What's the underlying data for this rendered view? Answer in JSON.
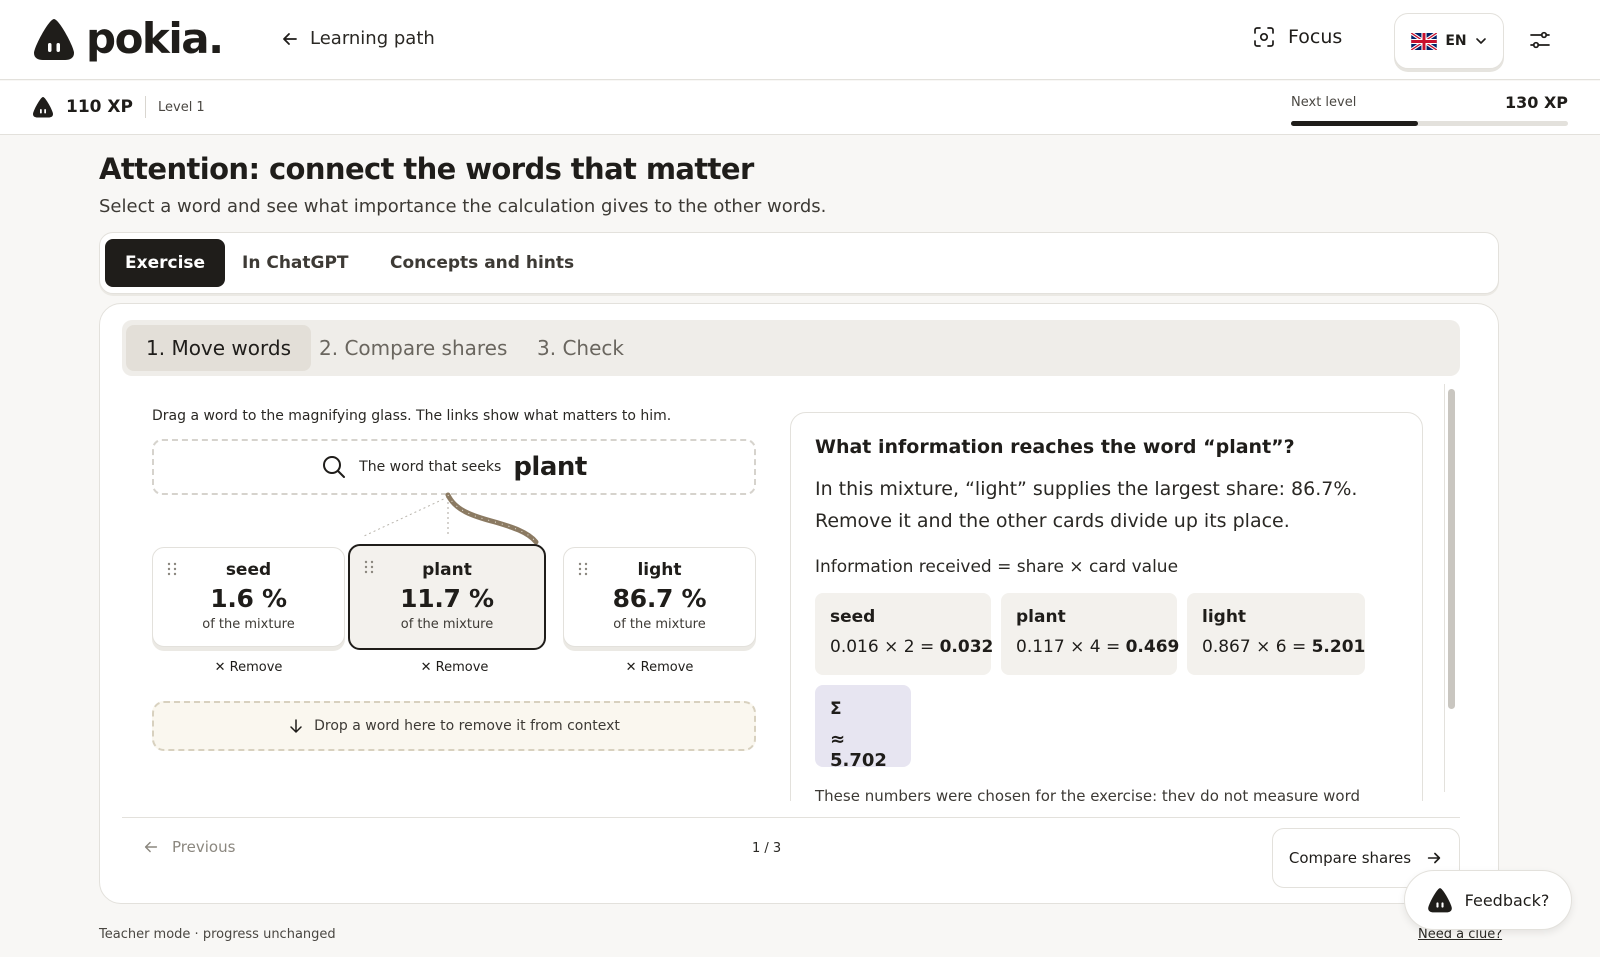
{
  "header": {
    "logo_text": "pokia.",
    "back_label": "Learning path",
    "focus_label": "Focus",
    "language": "EN"
  },
  "xp": {
    "current": "110 XP",
    "level": "Level 1",
    "next_label": "Next level",
    "next_value": "130 XP",
    "progress_fraction": 0.46
  },
  "page": {
    "title": "Attention: connect the words that matter",
    "subtitle": "Select a word and see what importance the calculation gives to the other words."
  },
  "tabs": [
    "Exercise",
    "In ChatGPT",
    "Concepts and hints"
  ],
  "steps": [
    "1. Move words",
    "2. Compare shares",
    "3. Check"
  ],
  "exercise": {
    "instruction": "Drag a word to the magnifying glass. The links show what matters to him.",
    "seek_label": "The word that seeks",
    "seek_word": "plant",
    "cards": [
      {
        "word": "seed",
        "pct": "1.6 %",
        "sub": "of the mixture",
        "remove": "Remove"
      },
      {
        "word": "plant",
        "pct": "11.7 %",
        "sub": "of the mixture",
        "remove": "Remove"
      },
      {
        "word": "light",
        "pct": "86.7 %",
        "sub": "of the mixture",
        "remove": "Remove"
      }
    ],
    "drop_label": "Drop a word here to remove it from context"
  },
  "info": {
    "title": "What information reaches the word “plant”?",
    "body": "In this mixture, “light” supplies the largest share: 86.7%. Remove it and the other cards divide up its place.",
    "formula": "Information received = share × card value",
    "calcs": [
      {
        "word": "seed",
        "expr": "0.016 × 2 = ",
        "result": "0.032"
      },
      {
        "word": "plant",
        "expr": "0.117 × 4 = ",
        "result": "0.469"
      },
      {
        "word": "light",
        "expr": "0.867 × 6 = ",
        "result": "5.201"
      }
    ],
    "sum_symbol": "Σ",
    "sum_value": "≈ 5.702",
    "note": "These numbers were chosen for the exercise; they do not measure word"
  },
  "nav": {
    "previous": "Previous",
    "counter": "1 / 3",
    "next": "Compare shares"
  },
  "footer": {
    "teacher": "Teacher mode · progress unchanged",
    "clue": "Need a clue?",
    "feedback": "Feedback?"
  }
}
